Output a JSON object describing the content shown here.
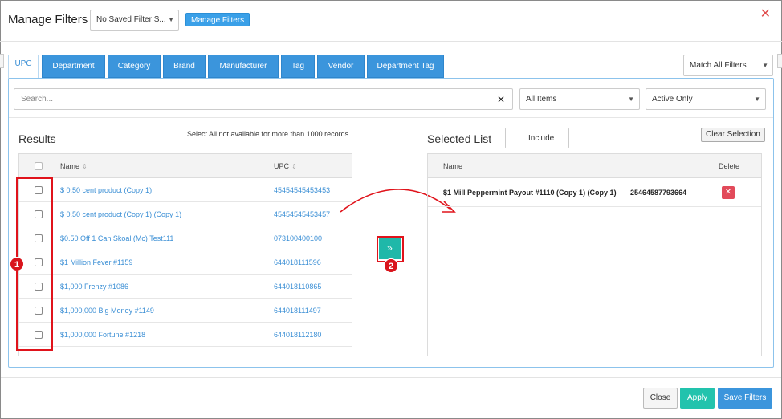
{
  "header": {
    "title": "Manage Filters",
    "saved_filter_value": "No Saved Filter S...",
    "manage_button": "Manage Filters",
    "close_icon": "close-icon"
  },
  "tabs": [
    {
      "label": "UPC",
      "active": true
    },
    {
      "label": "Department"
    },
    {
      "label": "Category"
    },
    {
      "label": "Brand"
    },
    {
      "label": "Manufacturer"
    },
    {
      "label": "Tag"
    },
    {
      "label": "Vendor"
    },
    {
      "label": "Department Tag"
    }
  ],
  "match_select": "Match All Filters",
  "search": {
    "placeholder": "Search...",
    "clear_icon": "x-icon"
  },
  "items_filter": "All Items",
  "status_filter": "Active Only",
  "results": {
    "title": "Results",
    "note": "Select All not available for more than 1000 records",
    "columns": {
      "name": "Name",
      "upc": "UPC"
    },
    "rows": [
      {
        "name": "$ 0.50 cent product (Copy 1)",
        "upc": "45454545453453"
      },
      {
        "name": "$ 0.50 cent product (Copy 1) (Copy 1)",
        "upc": "45454545453457"
      },
      {
        "name": "$0.50 Off 1 Can Skoal (Mc) Test111",
        "upc": "073100400100"
      },
      {
        "name": "$1 Million Fever #1159",
        "upc": "644018111596"
      },
      {
        "name": "$1,000 Frenzy #1086",
        "upc": "644018110865"
      },
      {
        "name": "$1,000,000 Big Money #1149",
        "upc": "644018111497"
      },
      {
        "name": "$1,000,000 Fortune #1218",
        "upc": "644018112180"
      }
    ]
  },
  "move_button_icon": "double-chevron-right-icon",
  "move_button_glyph": "»",
  "annotations": {
    "badge1": "1",
    "badge2": "2"
  },
  "selected": {
    "title": "Selected List",
    "include_label": "Include",
    "clear_button": "Clear Selection",
    "columns": {
      "name": "Name",
      "delete": "Delete"
    },
    "rows": [
      {
        "name": "$1 Mill Peppermint Payout #1110 (Copy 1) (Copy 1)",
        "upc": "25464587793664"
      }
    ]
  },
  "footer": {
    "close": "Close",
    "apply": "Apply",
    "save": "Save Filters"
  },
  "colors": {
    "primary": "#3b95dc",
    "teal": "#1fb8a9",
    "danger": "#e24a5a",
    "annotation": "#e0131b"
  }
}
